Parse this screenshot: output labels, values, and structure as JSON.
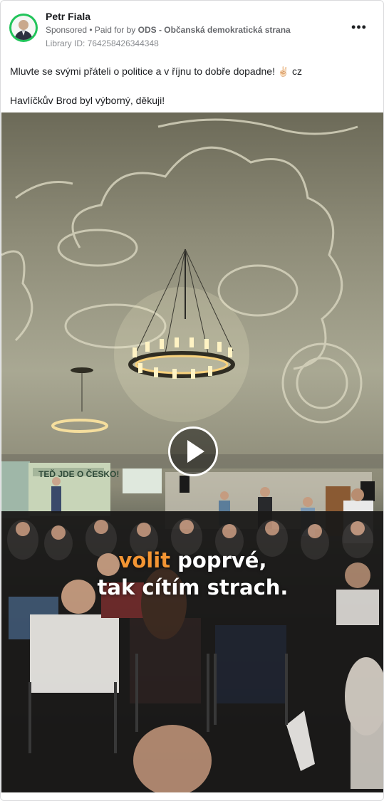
{
  "post": {
    "author": "Petr Fiala",
    "sponsored_label": "Sponsored",
    "paid_prefix": " • Paid for by ",
    "payer": "ODS - Občanská demokratická strana",
    "library_id": "Library ID: 764258426344348",
    "more_icon": "•••",
    "line1": "Mluvte se svými přáteli o politice a v říjnu to dobře dopadne! ",
    "emoji": "✌🏻",
    "line1_suffix": " cz",
    "line2": "Havlíčkův Brod byl výborný, děkuji!"
  },
  "video": {
    "caption_accent": "volit",
    "caption_rest": " poprvé,",
    "caption_line2": "tak cítím strach.",
    "banner_text": "TEĎ JDE O ČESKO!",
    "accent_color": "#f39533"
  },
  "icons": {
    "more": "more-options-icon",
    "play": "play-icon"
  }
}
